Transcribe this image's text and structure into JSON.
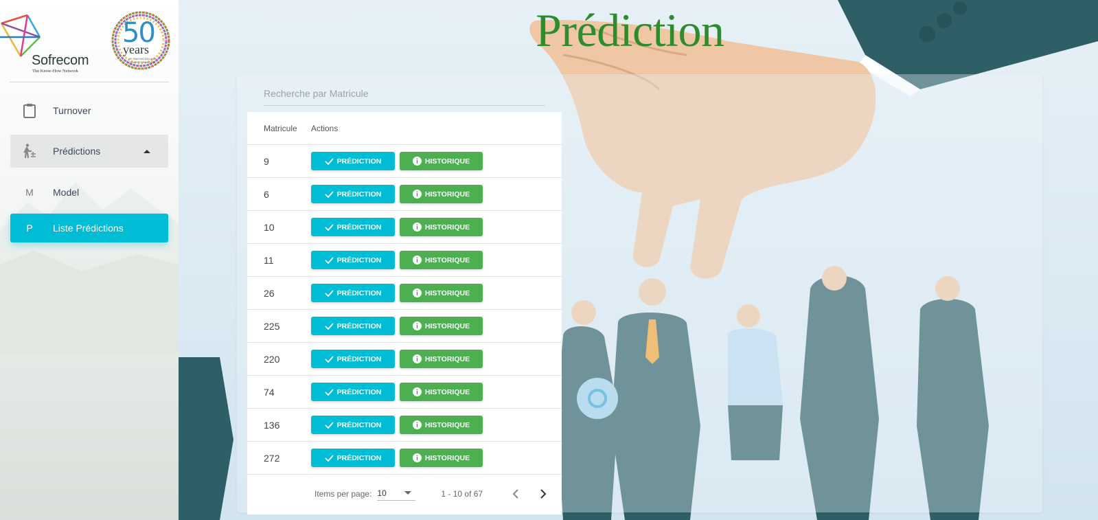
{
  "brand": {
    "name": "Sofrecom",
    "tagline": "The Know-How Network",
    "badge_number": "50",
    "badge_word": "years",
    "badge_small": "OF INNOVATION AND TRANSFORMATION"
  },
  "sidebar": {
    "items": [
      {
        "label": "Turnover",
        "icon": "clipboard-icon"
      },
      {
        "label": "Prédictions",
        "icon": "person-walking-icon"
      },
      {
        "label": "Model",
        "abbr": "M"
      },
      {
        "label": "Liste Prédictions",
        "abbr": "P"
      }
    ]
  },
  "page": {
    "title": "Prédiction"
  },
  "search": {
    "placeholder": "Recherche par Matricule"
  },
  "table": {
    "headers": [
      "Matricule",
      "Actions"
    ],
    "rows": [
      "9",
      "6",
      "10",
      "11",
      "26",
      "225",
      "220",
      "74",
      "136",
      "272"
    ],
    "prediction_label": "PRÉDICTION",
    "historique_label": "HISTORIQUE"
  },
  "paginator": {
    "items_per_page_label": "Items per page:",
    "page_size": "10",
    "range": "1 - 10 of 67"
  },
  "colors": {
    "accent_cyan": "#00bcd4",
    "accent_green": "#4caf50",
    "title_green": "#2e8b2e"
  }
}
